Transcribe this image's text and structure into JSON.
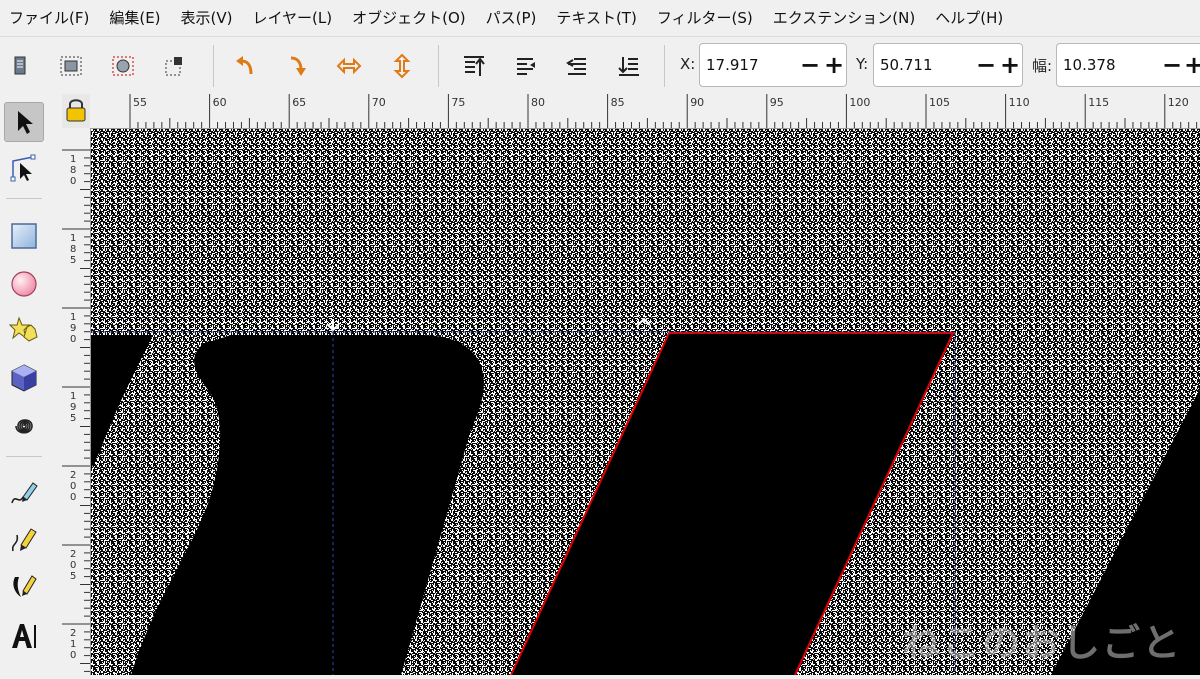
{
  "menubar": {
    "items": [
      "ファイル(F)",
      "編集(E)",
      "表示(V)",
      "レイヤー(L)",
      "オブジェクト(O)",
      "パス(P)",
      "テキスト(T)",
      "フィルター(S)",
      "エクステンション(N)",
      "ヘルプ(H)"
    ]
  },
  "toolbar": {
    "x_label": "X:",
    "x_value": "17.917",
    "y_label": "Y:",
    "y_value": "50.711",
    "w_label": "幅:",
    "w_value": "10.378",
    "minus": "−",
    "plus": "+"
  },
  "ruler": {
    "h_labels": [
      "55",
      "60",
      "65",
      "70",
      "75",
      "80",
      "85",
      "90",
      "95",
      "100",
      "105",
      "110",
      "115",
      "120"
    ],
    "v_labels": [
      "180",
      "185",
      "190",
      "195",
      "200",
      "205",
      "210"
    ]
  },
  "watermark": "ねこのおしごと",
  "colors": {
    "accent_orange": "#e07a14",
    "selection_red": "#e00000",
    "guide_blue": "#3344aa"
  }
}
